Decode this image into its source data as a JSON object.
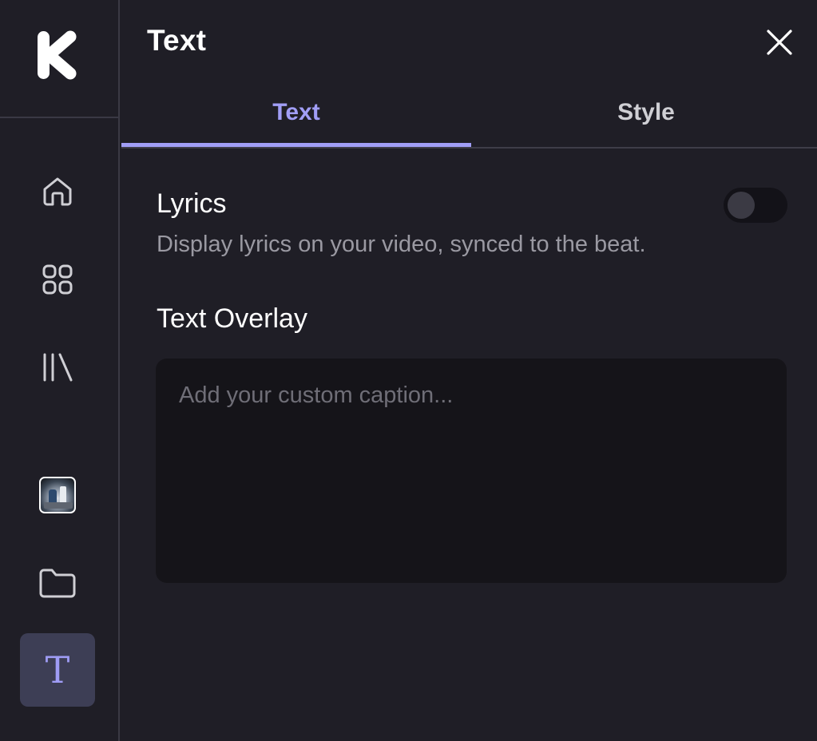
{
  "sidebar": {
    "logo": "k-logo",
    "items": [
      {
        "name": "home",
        "icon": "home-icon"
      },
      {
        "name": "apps",
        "icon": "grid-icon"
      },
      {
        "name": "library",
        "icon": "library-icon"
      },
      {
        "name": "media",
        "icon": "video-thumbnail"
      },
      {
        "name": "files",
        "icon": "folder-icon"
      },
      {
        "name": "text",
        "icon": "text-icon",
        "label": "T",
        "active": true
      }
    ]
  },
  "panel": {
    "title": "Text",
    "close_icon": "close-icon",
    "tabs": [
      {
        "label": "Text",
        "active": true
      },
      {
        "label": "Style",
        "active": false
      }
    ],
    "lyrics": {
      "title": "Lyrics",
      "description": "Display lyrics on your video, synced to the beat.",
      "enabled": false
    },
    "overlay": {
      "title": "Text Overlay",
      "value": "",
      "placeholder": "Add your custom caption..."
    }
  },
  "colors": {
    "background": "#1f1e26",
    "accent": "#a19ef6",
    "active_nav": "#3d3e55",
    "input_bg": "#151419",
    "muted_text": "#9a99a2"
  }
}
